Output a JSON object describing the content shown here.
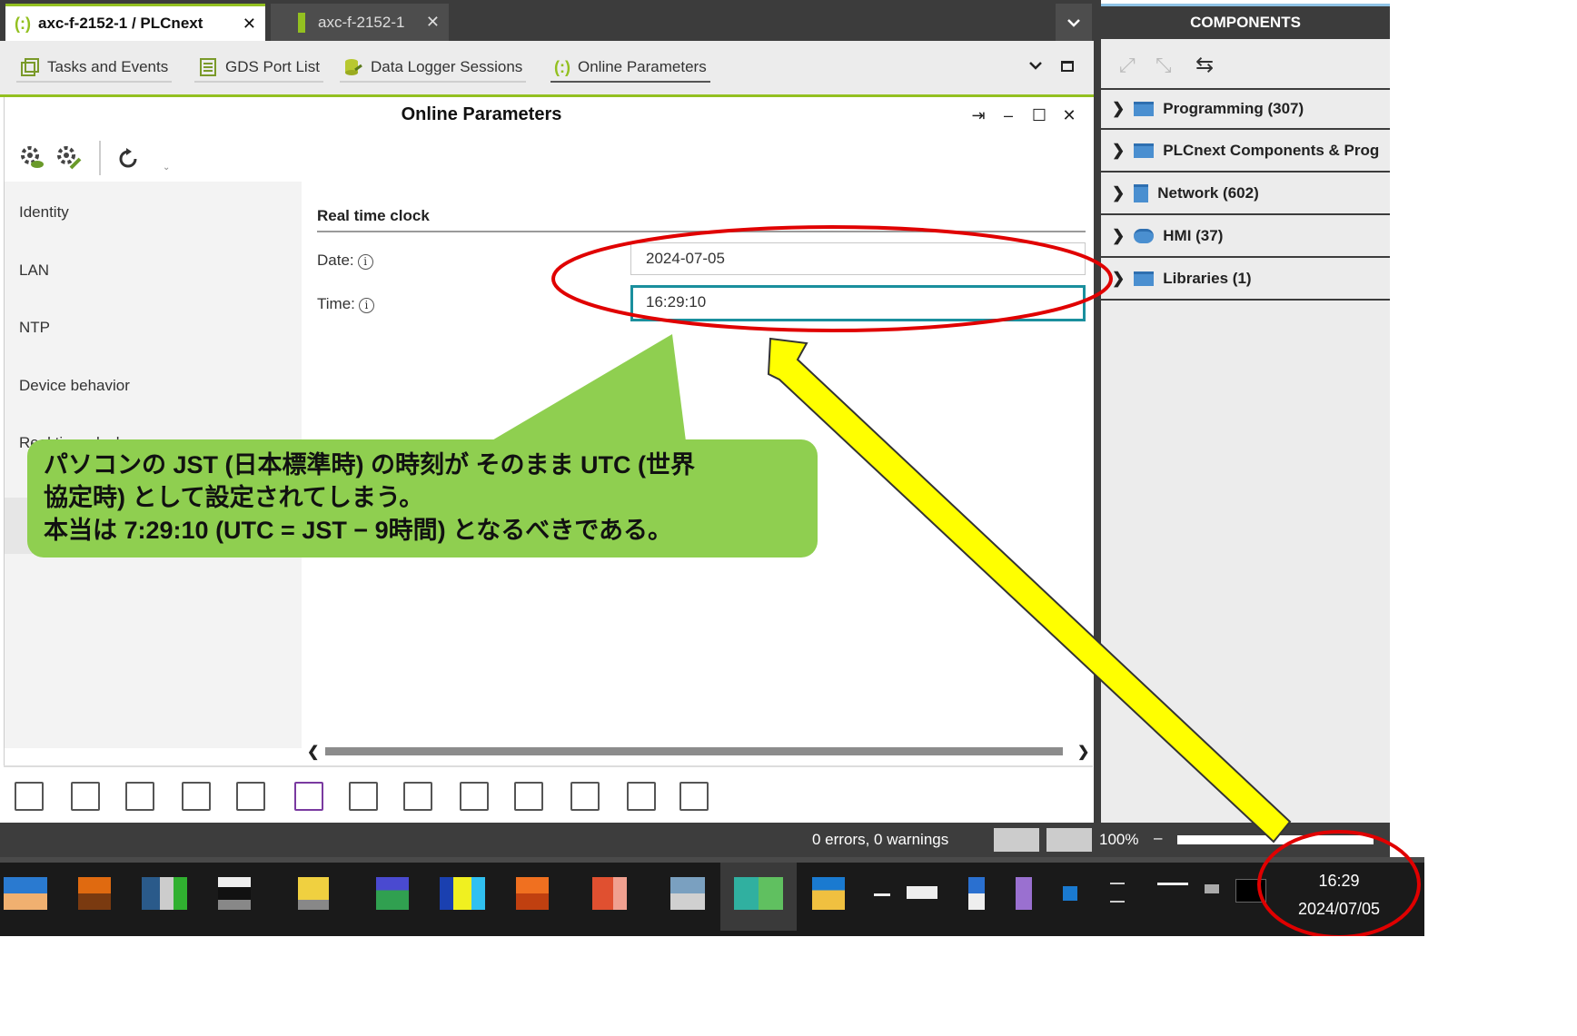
{
  "tabs": [
    {
      "label": "axc-f-2152-1 / PLCnext",
      "close": "✕"
    },
    {
      "label": "axc-f-2152-1",
      "close": "✕"
    }
  ],
  "tab_menu_glyph": "⌄",
  "subtabs": [
    {
      "label": "Tasks and Events"
    },
    {
      "label": "GDS Port List"
    },
    {
      "label": "Data Logger Sessions"
    },
    {
      "label": "Online Parameters"
    }
  ],
  "panel": {
    "title": "Online Parameters",
    "window_buttons": [
      "⇥",
      "–",
      "☐",
      "✕"
    ],
    "nav": [
      "Identity",
      "LAN",
      "NTP",
      "Device behavior",
      "Real time clock"
    ],
    "section_title": "Real time clock",
    "fields": {
      "date_label": "Date:",
      "date_value": "2024-07-05",
      "time_label": "Time:",
      "time_value": "16:29:10"
    },
    "scroll_left": "❮",
    "scroll_right": "❯"
  },
  "status": {
    "errors_text": "0 errors, 0 warnings",
    "zoom": "100%",
    "zoom_minus": "–"
  },
  "components": {
    "header": "COMPONENTS",
    "items": [
      {
        "label": "Programming (307)"
      },
      {
        "label": "PLCnext Components & Prog"
      },
      {
        "label": "Network (602)"
      },
      {
        "label": "HMI (37)"
      },
      {
        "label": "Libraries (1)"
      }
    ]
  },
  "taskbar": {
    "time": "16:29",
    "date": "2024/07/05"
  },
  "annotation": {
    "line1": "パソコンの JST (日本標準時) の時刻が そのまま UTC (世界",
    "line2": "協定時) として設定されてしまう。",
    "line3": "本当は 7:29:10 (UTC = JST − 9時間) となるべきである。"
  },
  "colors": {
    "accent": "#93c020",
    "focus": "#1a8f9d",
    "callout": "#8fcf50",
    "arrow": "#ffff00",
    "ring": "#e00000"
  }
}
